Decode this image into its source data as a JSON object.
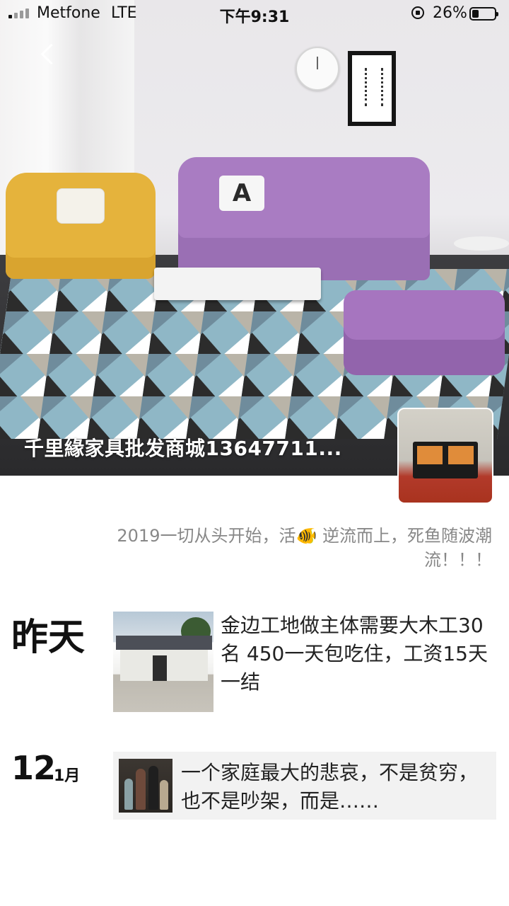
{
  "status_bar": {
    "carrier": "Metfone",
    "network": "LTE",
    "time": "下午9:31",
    "battery_percent": "26%",
    "signal_bars": 4,
    "signal_strength": 1
  },
  "profile": {
    "name": "千里緣家具批发商城13647711...",
    "cover_icon": "back-chevron-icon",
    "signature": "2019一切从头开始，活🐠 逆流而上，死鱼随波潮流！！！"
  },
  "posts": [
    {
      "date_label": "昨天",
      "text": "金边工地做主体需要大木工30名 450一天包吃住，工资15天一结"
    },
    {
      "day": "12",
      "month": "1月",
      "text": "一个家庭最大的悲哀，不是贫穷，也不是吵架，而是……"
    }
  ]
}
